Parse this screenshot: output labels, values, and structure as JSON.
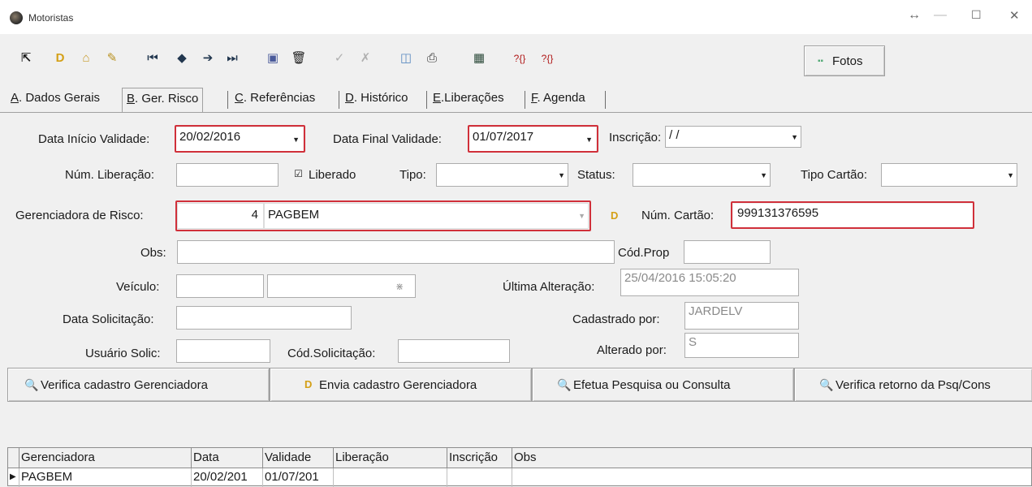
{
  "window": {
    "title": "Motoristas",
    "controls": [
      "↔",
      "—",
      "☐",
      "✕"
    ]
  },
  "toolbar": {
    "icons": [
      "exit-icon",
      "new-icon",
      "open-icon",
      "edit-icon",
      "first-icon",
      "prev-icon",
      "next-icon",
      "last-icon",
      "search-icon",
      "delete-icon",
      "confirm-icon",
      "cancel-icon",
      "preview-icon",
      "print-icon",
      "calculator-icon",
      "help-icon",
      "help2-icon"
    ],
    "fotos_label": "Fotos"
  },
  "tabs": [
    {
      "key": "A",
      "label": ". Dados Gerais"
    },
    {
      "key": "B",
      "label": ". Ger. Risco"
    },
    {
      "key": "C",
      "label": ". Referências"
    },
    {
      "key": "D",
      "label": ". Histórico"
    },
    {
      "key": "E",
      "label": ".Liberações"
    },
    {
      "key": "F",
      "label": ". Agenda"
    }
  ],
  "form": {
    "data_inicio_label": "Data Início Validade:",
    "data_inicio_value": "20/02/2016",
    "data_final_label": "Data Final Validade:",
    "data_final_value": "01/07/2017",
    "inscricao_label": "Inscrição:",
    "inscricao_value": " / /",
    "num_liberacao_label": "Núm. Liberação:",
    "num_liberacao_value": "",
    "liberado_label": "Liberado",
    "liberado_checked": true,
    "tipo_label": "Tipo:",
    "tipo_value": "",
    "status_label": "Status:",
    "status_value": "",
    "tipo_cartao_label": "Tipo Cartão:",
    "tipo_cartao_value": "",
    "gerenciadora_label": "Gerenciadora de Risco:",
    "gerenciadora_code": "4",
    "gerenciadora_name": "PAGBEM",
    "num_cartao_label": "Núm. Cartão:",
    "num_cartao_value": "999131376595",
    "obs_label": "Obs:",
    "obs_value": "",
    "cod_prop_label": "Cód.Prop",
    "cod_prop_value": "",
    "veiculo_label": "Veículo:",
    "veiculo_value": "",
    "ultima_alteracao_label": "Última Alteração:",
    "ultima_alteracao_value": "25/04/2016 15:05:20",
    "data_solicitacao_label": "Data Solicitação:",
    "data_solicitacao_value": "",
    "cadastrado_por_label": "Cadastrado por:",
    "cadastrado_por_value": "JARDELV",
    "usuario_solic_label": "Usuário Solic:",
    "usuario_solic_value": "",
    "cod_solicitacao_label": "Cód.Solicitação:",
    "cod_solicitacao_value": "",
    "alterado_por_label": "Alterado por:",
    "alterado_por_value": "S"
  },
  "buttons": {
    "verifica_cadastro": "Verifica cadastro Gerenciadora",
    "envia_cadastro": "Envia cadastro Gerenciadora",
    "efetua_pesquisa": "Efetua Pesquisa ou Consulta",
    "verifica_retorno": "Verifica retorno da Psq/Cons"
  },
  "grid": {
    "columns": [
      "Gerenciadora",
      "Data",
      "Validade",
      "Liberação",
      "Inscrição",
      "Obs"
    ],
    "rows": [
      [
        "PAGBEM",
        "20/02/201",
        "01/07/201",
        "",
        "",
        ""
      ]
    ]
  },
  "colors": {
    "highlight_red": "#d0303a",
    "window_bg": "#f0f0f0"
  }
}
